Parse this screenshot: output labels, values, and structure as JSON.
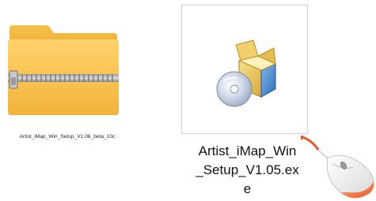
{
  "files": [
    {
      "name": "Artist_iMap_Win_Setup_V1.06_beta_10c",
      "type": "zip-folder-icon"
    },
    {
      "name_lines": [
        "Artist_iMap_Win",
        "_Setup_V1.05.ex",
        "e"
      ],
      "type": "installer-exe-icon",
      "selected": true
    }
  ],
  "pointer": {
    "type": "mouse-icon",
    "arrow_color": "#e8552a",
    "accent_color": "#f07a3a"
  }
}
